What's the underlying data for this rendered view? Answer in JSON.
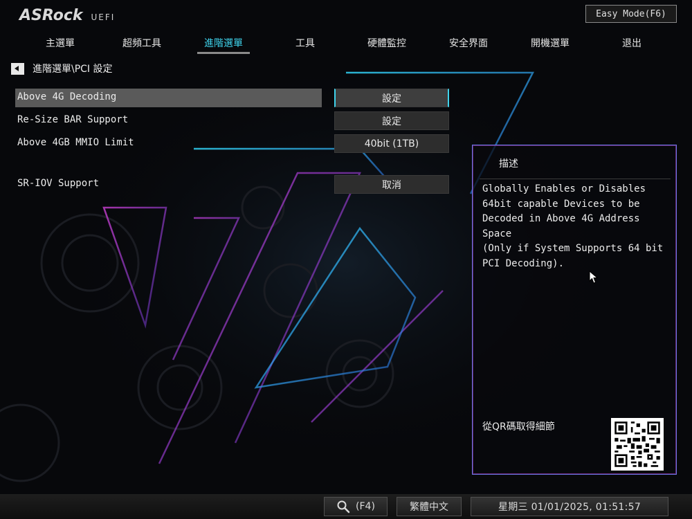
{
  "header": {
    "brand": "ASRock",
    "product": "UEFI",
    "easy_mode_label": "Easy Mode(F6)"
  },
  "tabs": [
    {
      "label": "主選單",
      "active": false
    },
    {
      "label": "超頻工具",
      "active": false
    },
    {
      "label": "進階選單",
      "active": true
    },
    {
      "label": "工具",
      "active": false
    },
    {
      "label": "硬體監控",
      "active": false
    },
    {
      "label": "安全界面",
      "active": false
    },
    {
      "label": "開機選單",
      "active": false
    },
    {
      "label": "退出",
      "active": false
    }
  ],
  "breadcrumb": {
    "path": "進階選單\\PCI 設定"
  },
  "settings": [
    {
      "label": "Above 4G Decoding",
      "value": "設定",
      "selected": true
    },
    {
      "label": "Re-Size BAR Support",
      "value": "設定",
      "selected": false
    },
    {
      "label": "Above 4GB MMIO Limit",
      "value": "40bit (1TB)",
      "selected": false
    },
    {
      "label": "SR-IOV Support",
      "value": "取消",
      "selected": false
    }
  ],
  "description": {
    "title": "描述",
    "text": "Globally Enables or Disables\n64bit capable Devices to be\nDecoded in Above 4G Address Space\n(Only if System Supports 64 bit\nPCI Decoding).",
    "qr_label": "從QR碼取得細節"
  },
  "bottom_bar": {
    "search_key": "(F4)",
    "language": "繁體中文",
    "datetime": "星期三 01/01/2025, 01:51:57"
  },
  "colors": {
    "accent": "#3fd3ec",
    "panel_border": "#6a78e8",
    "background": "#07080b"
  }
}
